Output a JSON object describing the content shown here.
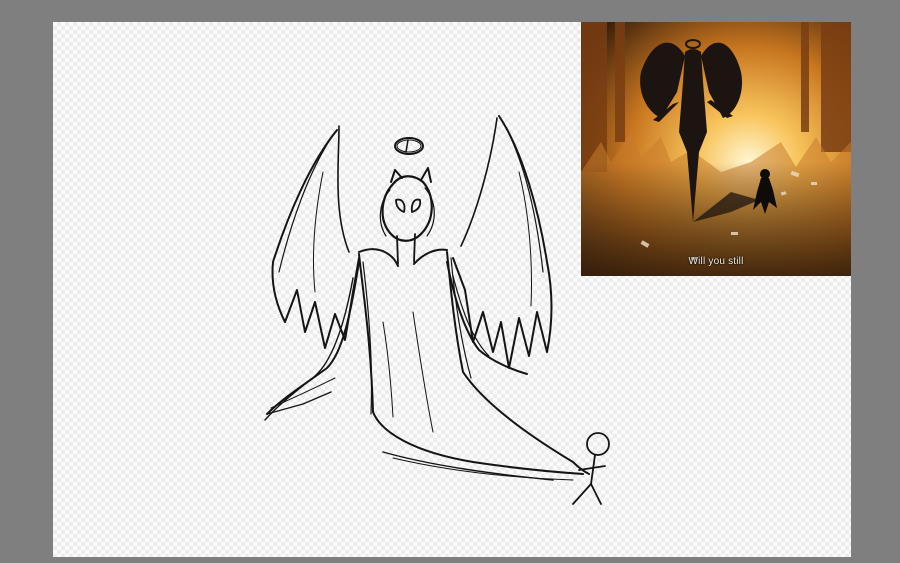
{
  "reference_image": {
    "subtitle": "Will you still"
  }
}
